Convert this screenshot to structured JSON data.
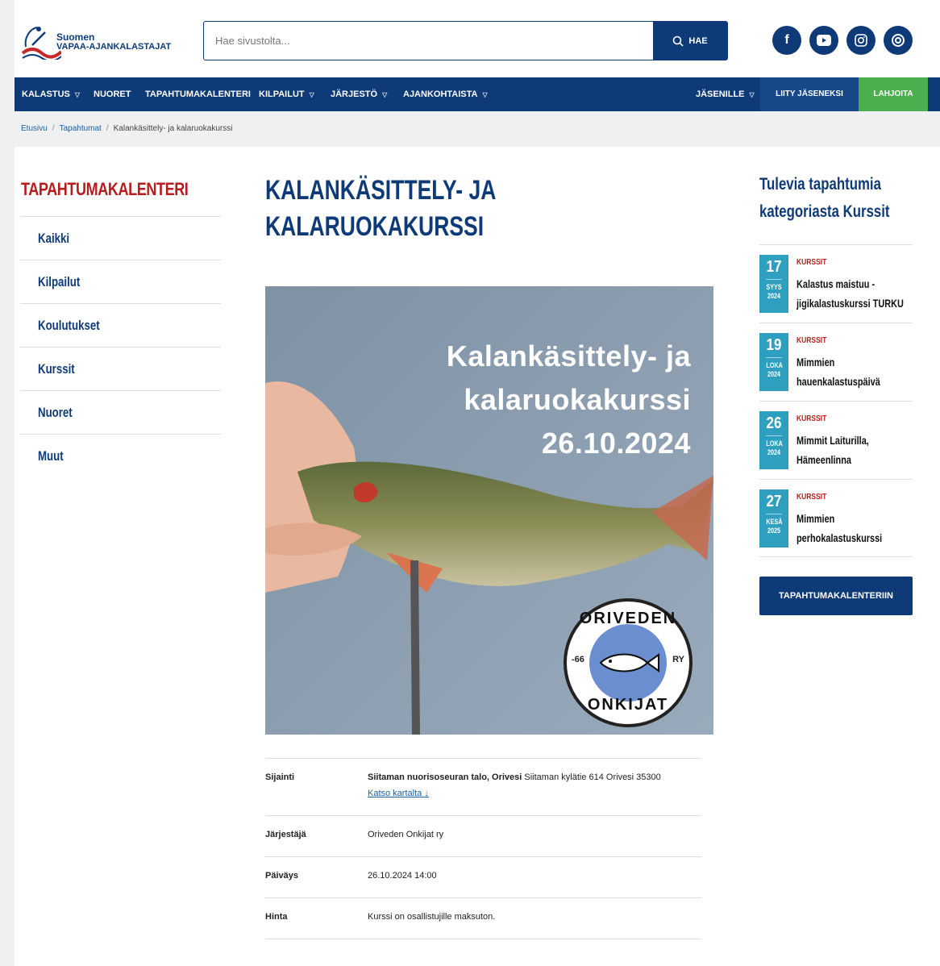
{
  "header": {
    "logo_line1": "Suomen",
    "logo_line2": "VAPAA-AJANKALASTAJAT",
    "search_placeholder": "Hae sivustolta...",
    "search_button": "HAE",
    "socials": [
      "facebook-icon",
      "youtube-icon",
      "instagram-icon",
      "threads-icon"
    ]
  },
  "nav": {
    "items": [
      "KALASTUS",
      "NUORET",
      "TAPAHTUMAKALENTERI",
      "KILPAILUT",
      "JÄRJESTÖ",
      "AJANKOHTAISTA"
    ],
    "members": "JÄSENILLE",
    "join": "LIITY JÄSENEKSI",
    "donate": "LAHJOITA"
  },
  "breadcrumb": [
    "Etusivu",
    "Tapahtumat",
    "Kalankäsittely- ja kalaruokakurssi"
  ],
  "sidebar": {
    "title": "TAPAHTUMAKALENTERI",
    "items": [
      "Kaikki",
      "Kilpailut",
      "Koulutukset",
      "Kurssit",
      "Nuoret",
      "Muut"
    ]
  },
  "main": {
    "title_line1": "KALANKÄSITTELY- JA",
    "title_line2": "KALARUOKAKURSSI",
    "hero_line1": "Kalankäsittely- ja",
    "hero_line2": "kalaruokakurssi",
    "hero_line3": "26.10.2024",
    "badge_top": "ORIVEDEN",
    "badge_bottom": "ONKIJAT",
    "badge_left": "-66",
    "badge_right": "RY",
    "info": {
      "location_label": "Sijainti",
      "location_name": "Siitaman nuorisoseuran talo, Orivesi",
      "location_address": "Siitaman kylätie 614 Orivesi 35300",
      "map_link": "Katso kartalta",
      "organizer_label": "Järjestäjä",
      "organizer": "Oriveden Onkijat ry",
      "date_label": "Päiväys",
      "date": "26.10.2024 14:00",
      "price_label": "Hinta",
      "price": "Kurssi on osallistujille maksuton."
    }
  },
  "upcoming": {
    "title_line1": "Tulevia tapahtumia",
    "title_line2": "kategoriasta Kurssit",
    "events": [
      {
        "day": "17",
        "month": "SYYS",
        "year": "2024",
        "cat": "KURSSIT",
        "line1": "Kalastus maistuu -",
        "line2": "jigikalastuskurssi TURKU"
      },
      {
        "day": "19",
        "month": "LOKA",
        "year": "2024",
        "cat": "KURSSIT",
        "line1": "Mimmien",
        "line2": "hauenkalastuspäivä"
      },
      {
        "day": "26",
        "month": "LOKA",
        "year": "2024",
        "cat": "KURSSIT",
        "line1": "Mimmit Laiturilla,",
        "line2": "Hämeenlinna"
      },
      {
        "day": "27",
        "month": "KESÄ",
        "year": "2025",
        "cat": "KURSSIT",
        "line1": "Mimmien",
        "line2": "perhokalastuskurssi"
      }
    ],
    "button": "TAPAHTUMAKALENTERIIN"
  }
}
